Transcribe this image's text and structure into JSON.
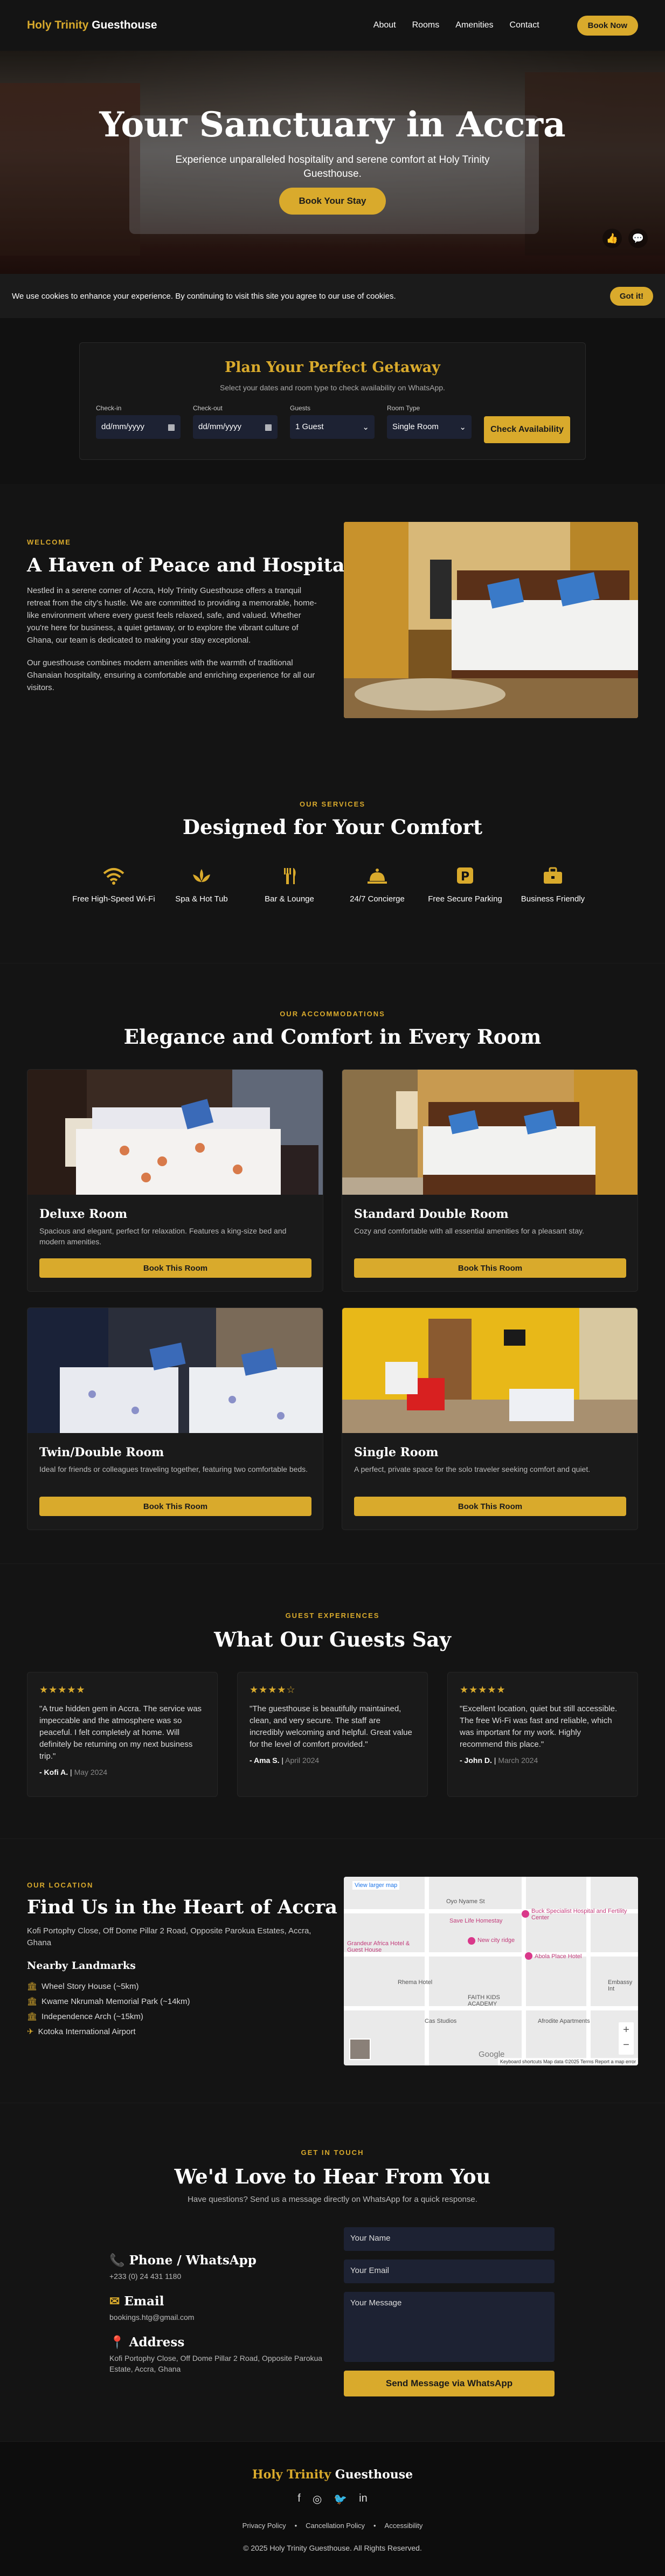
{
  "nav": {
    "brand_first": "Holy Trinity",
    "brand_second": "Guesthouse",
    "links": [
      "About",
      "Rooms",
      "Amenities",
      "Contact"
    ],
    "book_label": "Book Now"
  },
  "hero": {
    "title": "Your Sanctuary in Accra",
    "subtitle": "Experience unparalleled hospitality and serene comfort at Holy Trinity Guesthouse.",
    "cta": "Book Your Stay"
  },
  "cookie": {
    "text": "We use cookies to enhance your experience. By continuing to visit this site you agree to our use of cookies.",
    "button": "Got it!"
  },
  "booking": {
    "title": "Plan Your Perfect Getaway",
    "subtitle": "Select your dates and room type to check availability on WhatsApp.",
    "checkin_label": "Check-in",
    "checkin_value": "dd/mm/yyyy",
    "checkout_label": "Check-out",
    "checkout_value": "dd/mm/yyyy",
    "guests_label": "Guests",
    "guests_value": "1 Guest",
    "roomtype_label": "Room Type",
    "roomtype_value": "Single Room",
    "button": "Check Availability"
  },
  "welcome": {
    "eyebrow": "WELCOME",
    "title": "A Haven of Peace and Hospitality",
    "p1": "Nestled in a serene corner of Accra, Holy Trinity Guesthouse offers a tranquil retreat from the city's hustle. We are committed to providing a memorable, home-like environment where every guest feels relaxed, safe, and valued. Whether you're here for business, a quiet getaway, or to explore the vibrant culture of Ghana, our team is dedicated to making your stay exceptional.",
    "p2": "Our guesthouse combines modern amenities with the warmth of traditional Ghanaian hospitality, ensuring a comfortable and enriching experience for all our visitors."
  },
  "services": {
    "eyebrow": "OUR SERVICES",
    "title": "Designed for Your Comfort",
    "items": [
      {
        "label": "Free High-Speed Wi-Fi",
        "icon": "wifi-icon"
      },
      {
        "label": "Spa & Hot Tub",
        "icon": "spa-icon"
      },
      {
        "label": "Bar & Lounge",
        "icon": "utensils-icon"
      },
      {
        "label": "24/7 Concierge",
        "icon": "concierge-bell-icon"
      },
      {
        "label": "Free Secure Parking",
        "icon": "parking-icon"
      },
      {
        "label": "Business Friendly",
        "icon": "briefcase-icon"
      }
    ]
  },
  "rooms": {
    "eyebrow": "OUR ACCOMMODATIONS",
    "title": "Elegance and Comfort in Every Room",
    "button_label": "Book This Room",
    "items": [
      {
        "name": "Deluxe Room",
        "desc": "Spacious and elegant, perfect for relaxation. Features a king-size bed and modern amenities."
      },
      {
        "name": "Standard Double Room",
        "desc": "Cozy and comfortable with all essential amenities for a pleasant stay."
      },
      {
        "name": "Twin/Double Room",
        "desc": "Ideal for friends or colleagues traveling together, featuring two comfortable beds."
      },
      {
        "name": "Single Room",
        "desc": "A perfect, private space for the solo traveler seeking comfort and quiet."
      }
    ]
  },
  "testimonials": {
    "eyebrow": "GUEST EXPERIENCES",
    "title": "What Our Guests Say",
    "items": [
      {
        "stars": "★★★★★",
        "quote": "\"A true hidden gem in Accra. The service was impeccable and the atmosphere was so peaceful. I felt completely at home. Will definitely be returning on my next business trip.\"",
        "name": "- Kofi A.",
        "date": "May 2024"
      },
      {
        "stars": "★★★★☆",
        "quote": "\"The guesthouse is beautifully maintained, clean, and very secure. The staff are incredibly welcoming and helpful. Great value for the level of comfort provided.\"",
        "name": "- Ama S.",
        "date": "April 2024"
      },
      {
        "stars": "★★★★★",
        "quote": "\"Excellent location, quiet but still accessible. The free Wi-Fi was fast and reliable, which was important for my work. Highly recommend this place.\"",
        "name": "- John D.",
        "date": "March 2024"
      }
    ]
  },
  "location": {
    "eyebrow": "OUR LOCATION",
    "title": "Find Us in the Heart of Accra",
    "address": "Kofi Portophy Close, Off Dome Pillar 2 Road, Opposite Parokua Estates, Accra, Ghana",
    "landmarks_title": "Nearby Landmarks",
    "landmarks": [
      {
        "icon": "building-icon",
        "text": "Wheel Story House (~5km)"
      },
      {
        "icon": "landmark-icon",
        "text": "Kwame Nkrumah Memorial Park (~14km)"
      },
      {
        "icon": "monument-icon",
        "text": "Independence Arch (~15km)"
      },
      {
        "icon": "plane-icon",
        "text": "Kotoka International Airport"
      }
    ],
    "map": {
      "view_larger": "View larger map",
      "labels": [
        "Oyo Nyame St",
        "Buck Specialist Hospital and Fertility Center",
        "Save Life Homestay",
        "Grandeur Africa Hotel & Guest House",
        "New city ridge",
        "Abola Place Hotel",
        "Rhema Hotel",
        "FAITH KIDS ACADEMY",
        "Cas Studios",
        "Afrodite Apartments",
        "Embassy Int"
      ],
      "attribution": "Keyboard shortcuts   Map data ©2025   Terms   Report a map error",
      "logo": "Google"
    }
  },
  "contact": {
    "eyebrow": "GET IN TOUCH",
    "title": "We'd Love to Hear From You",
    "subtitle": "Have questions? Send us a message directly on WhatsApp for a quick response.",
    "phone_title": "Phone / WhatsApp",
    "phone_value": "+233 (0) 24 431 1180",
    "email_title": "Email",
    "email_value": "bookings.htg@gmail.com",
    "address_title": "Address",
    "address_value": "Kofi Portophy Close, Off Dome Pillar 2 Road, Opposite Parokua Estate, Accra, Ghana",
    "name_placeholder": "Your Name",
    "email_placeholder": "Your Email",
    "message_placeholder": "Your Message",
    "send_label": "Send Message via WhatsApp"
  },
  "footer": {
    "brand_first": "Holy Trinity",
    "brand_second": "Guesthouse",
    "links": [
      "Privacy Policy",
      "Cancellation Policy",
      "Accessibility"
    ],
    "copyright": "© 2025 Holy Trinity Guesthouse. All Rights Reserved."
  },
  "colors": {
    "accent": "#d9aa2c",
    "background": "#141414",
    "input": "#1d2233"
  }
}
